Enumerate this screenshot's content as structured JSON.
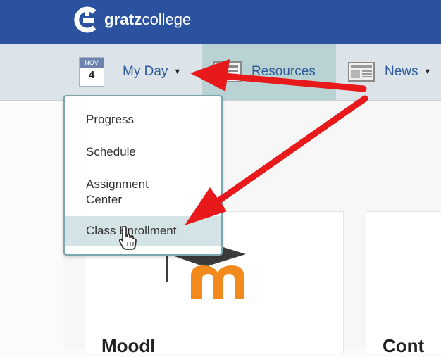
{
  "header": {
    "brand_strong": "gratz",
    "brand_light": "college",
    "brand_color": "#2a529f"
  },
  "nav": {
    "calendar": {
      "month": "NOV",
      "day": "4"
    },
    "items": [
      {
        "label": "My Day",
        "icon": "calendar-icon"
      },
      {
        "label": "Resources",
        "icon": "resources-icon"
      },
      {
        "label": "News",
        "icon": "newspaper-icon"
      }
    ]
  },
  "dropdown": {
    "items": [
      {
        "label": "Progress"
      },
      {
        "label": "Schedule"
      },
      {
        "label": "Assignment Center"
      },
      {
        "label": "Class Enrollment",
        "highlighted": true
      }
    ]
  },
  "cards": [
    {
      "title": "Moodl",
      "logo": "moodle-logo"
    },
    {
      "title": "Cont"
    }
  ],
  "annotations": {
    "arrow_color": "#e8191b",
    "cursor": "hand-pointer-icon"
  }
}
